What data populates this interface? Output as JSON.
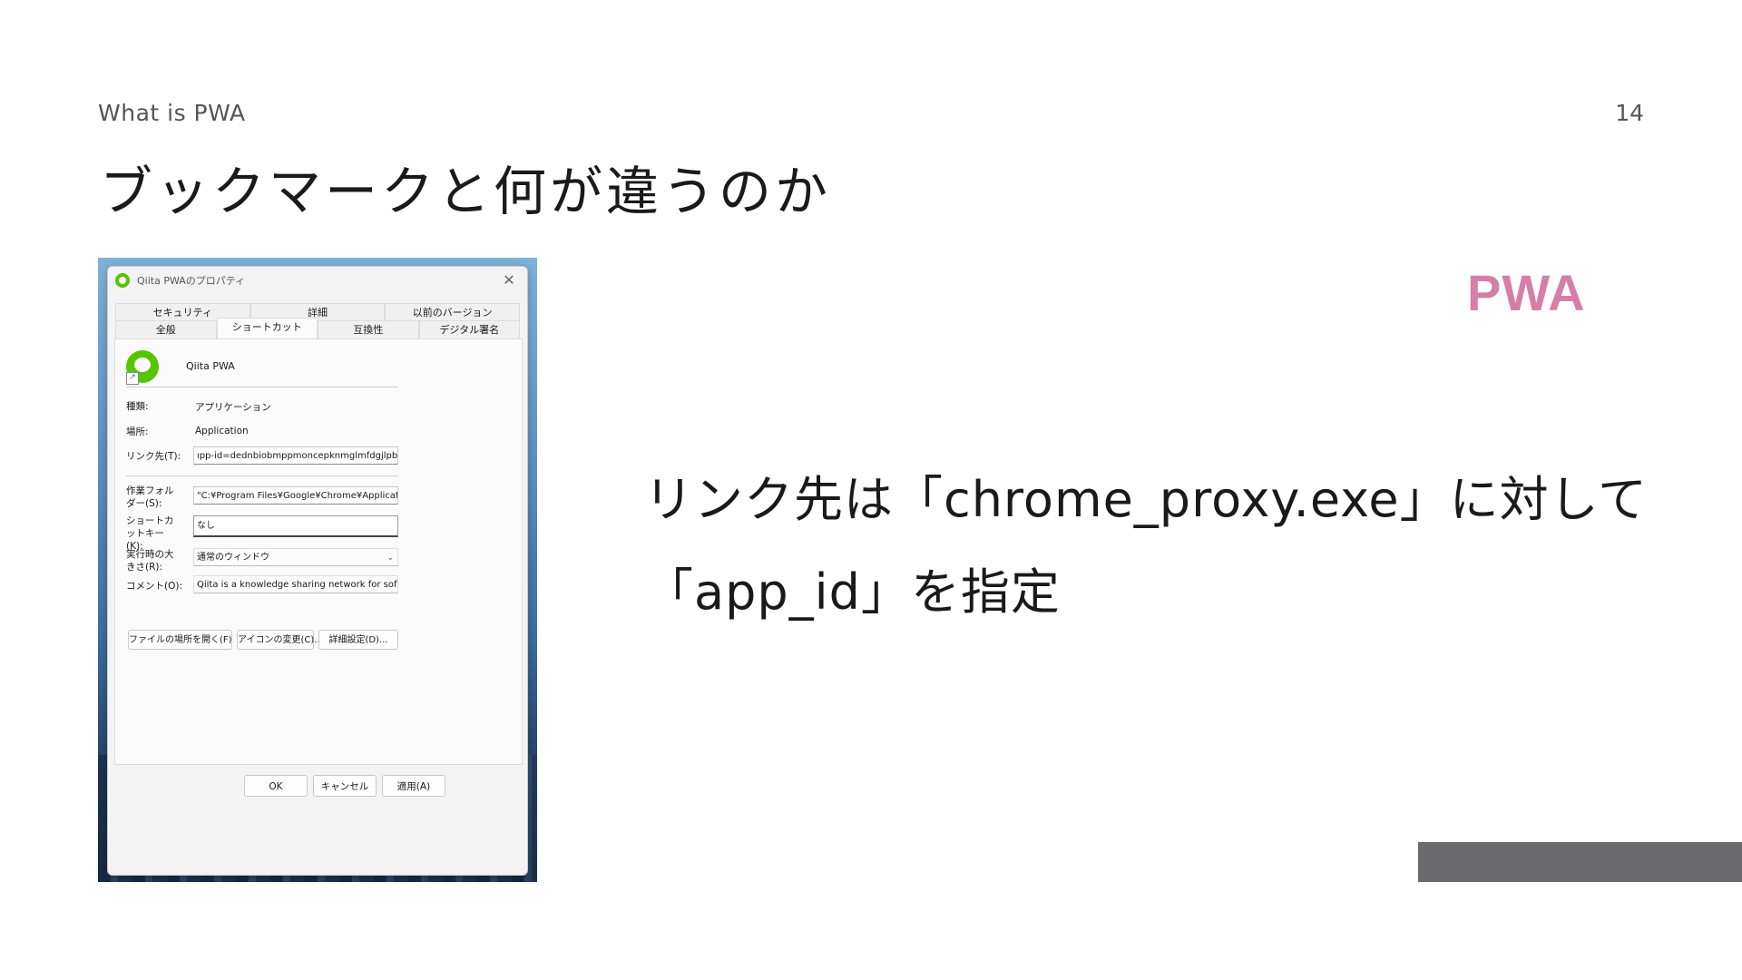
{
  "slide": {
    "section": "What is PWA",
    "page_number": "14",
    "title": "ブックマークと何が違うのか",
    "tag": "PWA",
    "body_line1": "リンク先は「chrome_proxy.exe」に対して",
    "body_line2": "「app_id」を指定",
    "accent_color": "#d57fa8",
    "footer_bar_color": "#6b6b6d"
  },
  "dialog": {
    "title": "Qiita PWAのプロパティ",
    "tabs_row1": [
      "セキュリティ",
      "詳細",
      "以前のバージョン"
    ],
    "tabs_row2": [
      "全般",
      "ショートカット",
      "互換性",
      "デジタル署名"
    ],
    "active_tab": "ショートカット",
    "app_name": "Qiita PWA",
    "fields": {
      "type_label": "種類:",
      "type_value": "アプリケーション",
      "location_label": "場所:",
      "location_value": "Application",
      "target_label": "リンク先(T):",
      "target_value": "ıpp-id=dednbiobmppmoncepknmglmfdgjlpbgk",
      "start_in_label": "作業フォルダー(S):",
      "start_in_value": "\"C:¥Program Files¥Google¥Chrome¥Application\"",
      "shortcut_key_label": "ショートカットキー(K):",
      "shortcut_key_value": "なし",
      "run_label": "実行時の大きさ(R):",
      "run_value": "通常のウィンドウ",
      "comment_label": "コメント(O):",
      "comment_value": "Qiita is a knowledge sharing network for softwa"
    },
    "buttons": {
      "open_location": "ファイルの場所を開く(F)",
      "change_icon": "アイコンの変更(C)...",
      "advanced": "詳細設定(D)...",
      "ok": "OK",
      "cancel": "キャンセル",
      "apply": "適用(A)"
    },
    "icons": {
      "app": "qiita-icon",
      "close": "close-icon",
      "shortcut_overlay": "shortcut-arrow-icon",
      "dropdown": "chevron-down-icon"
    }
  }
}
